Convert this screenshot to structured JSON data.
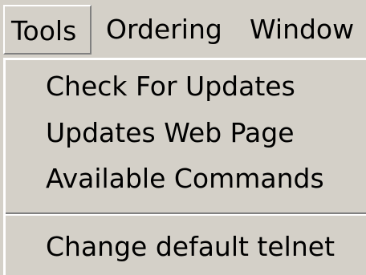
{
  "menubar": {
    "items": [
      {
        "label": "Tools"
      },
      {
        "label": "Ordering"
      },
      {
        "label": "Window"
      }
    ]
  },
  "dropdown": {
    "items": [
      {
        "label": "Check For Updates"
      },
      {
        "label": "Updates Web Page"
      },
      {
        "label": "Available Commands"
      },
      {
        "label": "Change default telnet"
      }
    ]
  },
  "colors": {
    "menu_bg": "#d4d0c8",
    "highlight": "#ffffff",
    "shadow": "#808080"
  }
}
